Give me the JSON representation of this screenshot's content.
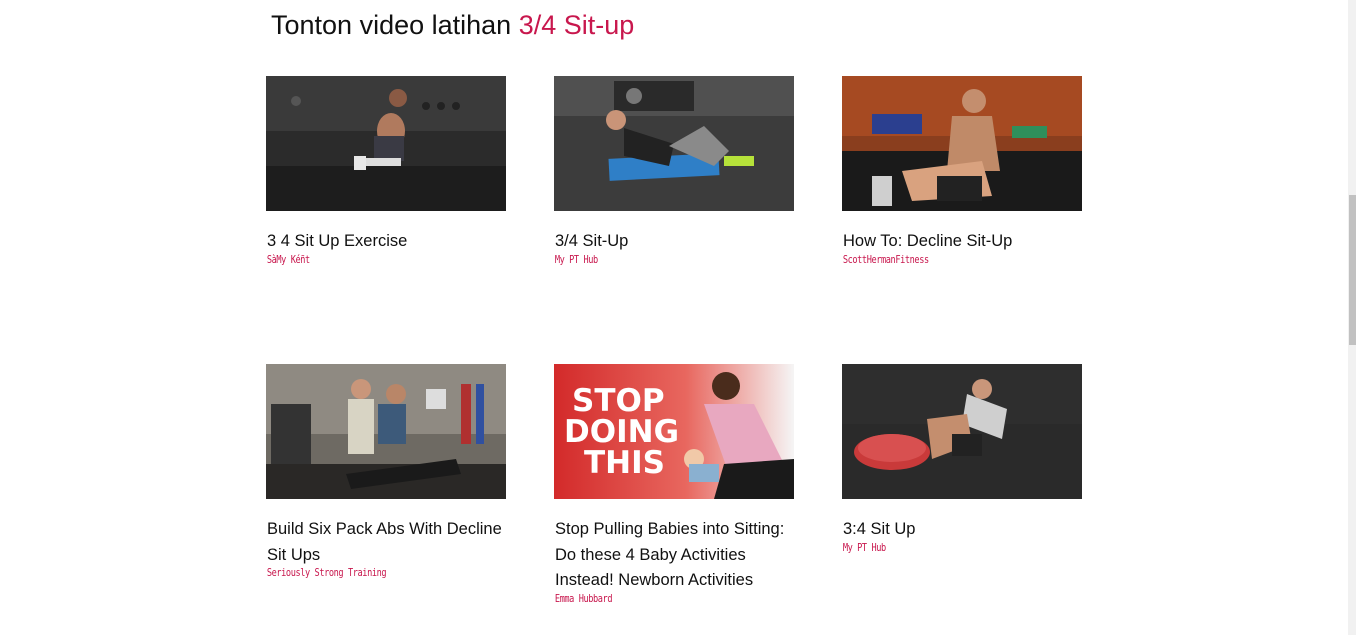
{
  "heading": {
    "prefix": "Tonton video latihan",
    "accent": "3/4 Sit-up"
  },
  "videos": [
    {
      "title": "3 4 Sit Up Exercise",
      "channel": "SàMy Kéñt"
    },
    {
      "title": "3/4 Sit-Up",
      "channel": "My PT Hub"
    },
    {
      "title": "How To: Decline Sit-Up",
      "channel": "ScottHermanFitness"
    },
    {
      "title": "Build Six Pack Abs With Decline Sit Ups",
      "channel": "Seriously Strong Training"
    },
    {
      "title": "Stop Pulling Babies into Sitting: Do these 4 Baby Activities Instead! Newborn Activities",
      "channel": "Emma Hubbard",
      "thumbnail_text": [
        "STOP",
        "DOING",
        "THIS"
      ]
    },
    {
      "title": "3:4 Sit Up",
      "channel": "My PT Hub"
    }
  ],
  "colors": {
    "accent": "#c8174d",
    "text": "#111111"
  }
}
